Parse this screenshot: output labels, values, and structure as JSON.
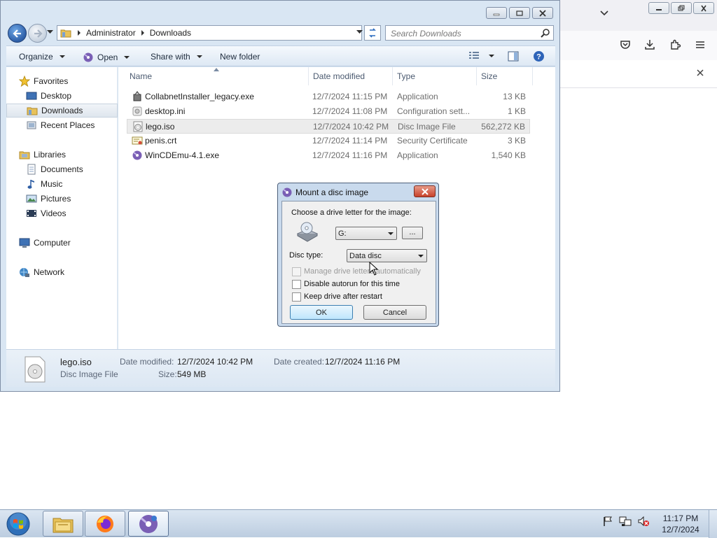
{
  "explorer": {
    "breadcrumb": [
      "Administrator",
      "Downloads"
    ],
    "search_placeholder": "Search Downloads",
    "toolbar": {
      "organize": "Organize",
      "open": "Open",
      "share_with": "Share with",
      "new_folder": "New folder"
    },
    "nav": {
      "favorites": "Favorites",
      "desktop": "Desktop",
      "downloads": "Downloads",
      "recent_places": "Recent Places",
      "libraries": "Libraries",
      "documents": "Documents",
      "music": "Music",
      "pictures": "Pictures",
      "videos": "Videos",
      "computer": "Computer",
      "network": "Network"
    },
    "columns": {
      "name": "Name",
      "date_modified": "Date modified",
      "type": "Type",
      "size": "Size"
    },
    "files": [
      {
        "name": "CollabnetInstaller_legacy.exe",
        "date": "12/7/2024 11:15 PM",
        "type": "Application",
        "size": "13 KB",
        "icon": "installer-icon"
      },
      {
        "name": "desktop.ini",
        "date": "12/7/2024 11:08 PM",
        "type": "Configuration sett...",
        "size": "1 KB",
        "icon": "settings-file-icon"
      },
      {
        "name": "lego.iso",
        "date": "12/7/2024 10:42 PM",
        "type": "Disc Image File",
        "size": "562,272 KB",
        "icon": "disc-image-icon"
      },
      {
        "name": "penis.crt",
        "date": "12/7/2024 11:14 PM",
        "type": "Security Certificate",
        "size": "3 KB",
        "icon": "certificate-icon"
      },
      {
        "name": "WinCDEmu-4.1.exe",
        "date": "12/7/2024 11:16 PM",
        "type": "Application",
        "size": "1,540 KB",
        "icon": "wincdemu-icon"
      }
    ],
    "details": {
      "filename": "lego.iso",
      "filetype": "Disc Image File",
      "date_modified_label": "Date modified:",
      "date_modified": "12/7/2024 10:42 PM",
      "date_created_label": "Date created:",
      "date_created": "12/7/2024 11:16 PM",
      "size_label": "Size:",
      "size": "549 MB"
    }
  },
  "dialog": {
    "title": "Mount a disc image",
    "prompt": "Choose a drive letter for the image:",
    "drive_letter": "G:",
    "browse_label": "...",
    "disc_type_label": "Disc type:",
    "disc_type": "Data disc",
    "opt_manage": "Manage drive letters automatically",
    "opt_autorun": "Disable autorun for this time",
    "opt_keep": "Keep drive after restart",
    "ok": "OK",
    "cancel": "Cancel"
  },
  "taskbar": {
    "time": "11:17 PM",
    "date": "12/7/2024"
  },
  "colors": {
    "window_frame": "#d9e6f3",
    "dialog_frame": "#c9daed",
    "close_red": "#c8422b",
    "selection": "#dfe6ee"
  }
}
